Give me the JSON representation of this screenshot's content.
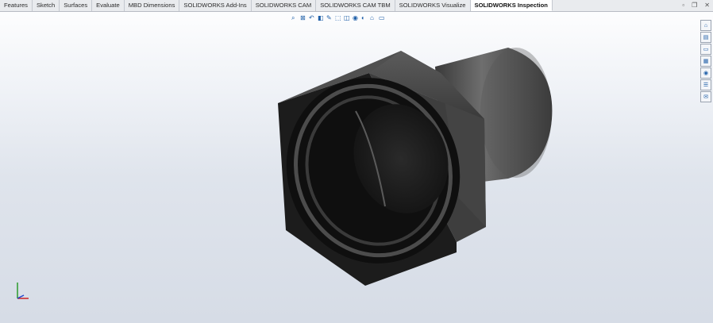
{
  "tabs": [
    {
      "label": "Features"
    },
    {
      "label": "Sketch"
    },
    {
      "label": "Surfaces"
    },
    {
      "label": "Evaluate"
    },
    {
      "label": "MBD Dimensions"
    },
    {
      "label": "SOLIDWORKS Add-Ins"
    },
    {
      "label": "SOLIDWORKS CAM"
    },
    {
      "label": "SOLIDWORKS CAM TBM"
    },
    {
      "label": "SOLIDWORKS Visualize"
    },
    {
      "label": "SOLIDWORKS Inspection"
    }
  ],
  "active_tab": "SOLIDWORKS Inspection",
  "window_controls": {
    "minimize": "▫",
    "restore": "❐",
    "close": "✕"
  },
  "heads_up_toolbar": [
    {
      "icon": "zoom-to-fit-icon"
    },
    {
      "icon": "zoom-to-area-icon"
    },
    {
      "icon": "previous-view-icon"
    },
    {
      "icon": "section-view-icon"
    },
    {
      "icon": "dynamic-annotation-icon"
    },
    {
      "icon": "view-orientation-icon"
    },
    {
      "icon": "display-style-icon"
    },
    {
      "icon": "hide-show-items-icon"
    },
    {
      "icon": "edit-appearance-icon"
    },
    {
      "icon": "apply-scene-icon"
    },
    {
      "icon": "view-settings-icon"
    }
  ],
  "task_pane": [
    {
      "icon": "solidworks-resources-icon"
    },
    {
      "icon": "design-library-icon"
    },
    {
      "icon": "file-explorer-icon"
    },
    {
      "icon": "view-palette-icon"
    },
    {
      "icon": "appearances-icon"
    },
    {
      "icon": "custom-properties-icon"
    },
    {
      "icon": "solidworks-forum-icon"
    }
  ],
  "colors": {
    "accent": "#1f5fa8",
    "model_dark": "#2a2a2a",
    "model_mid": "#4a4a4a",
    "model_light": "#8a8a8a"
  }
}
